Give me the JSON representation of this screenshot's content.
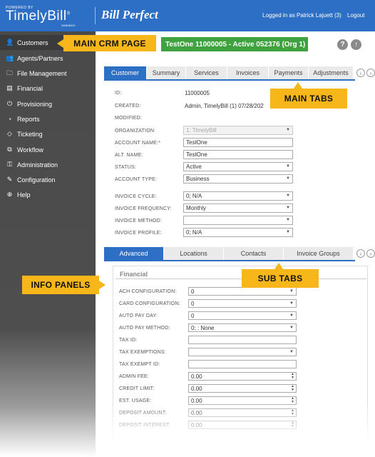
{
  "header": {
    "powered_by": "POWERED BY",
    "logo": "TimelyBill",
    "logo_reg": "®",
    "logo_sub": "SANDBOX",
    "brand": "Bill Perfect",
    "user": "Logged in as Patrick Lajuett (3)",
    "logout": "Logout"
  },
  "sidebar": {
    "items": [
      {
        "label": "Customers",
        "icon": "person-icon",
        "glyph": "👤"
      },
      {
        "label": "Agents/Partners",
        "icon": "people-icon",
        "glyph": "👥"
      },
      {
        "label": "File Management",
        "icon": "folder-icon",
        "glyph": "🗀"
      },
      {
        "label": "Financial",
        "icon": "ledger-icon",
        "glyph": "▤"
      },
      {
        "label": "Provisioning",
        "icon": "power-icon",
        "glyph": "⏻"
      },
      {
        "label": "Reports",
        "icon": "pie-chart-icon",
        "glyph": "◔"
      },
      {
        "label": "Ticketing",
        "icon": "tag-icon",
        "glyph": "◇"
      },
      {
        "label": "Workflow",
        "icon": "sitemap-icon",
        "glyph": "⧉"
      },
      {
        "label": "Administration",
        "icon": "key-icon",
        "glyph": "⚿"
      },
      {
        "label": "Configuration",
        "icon": "wrench-icon",
        "glyph": "✎"
      },
      {
        "label": "Help",
        "icon": "lifebuoy-icon",
        "glyph": "⊕"
      }
    ]
  },
  "callouts": {
    "main_crm": "MAIN CRM PAGE",
    "main_tabs": "MAIN TABS",
    "sub_tabs": "SUB TABS",
    "info_panels": "INFO PANELS"
  },
  "record": {
    "title": "TestOne   11000005 - Active 052376 (Org 1)",
    "help": "?",
    "up": "↑"
  },
  "main_tabs": [
    "Customer",
    "Summary",
    "Services",
    "Invoices",
    "Payments",
    "Adjustments"
  ],
  "sub_tabs": [
    "Advanced",
    "Locations",
    "Contacts",
    "Invoice Groups"
  ],
  "nav": {
    "prev": "‹",
    "next": "›"
  },
  "customer": {
    "id_label": "ID:",
    "id_value": "11000005",
    "created_label": "CREATED:",
    "created_value": "Admin, TimelyBill (1) 07/28/202",
    "modified_label": "MODIFIED:",
    "organization_label": "ORGANIZATION:",
    "organization_value": "1: TimelyBill",
    "account_name_label": "ACCOUNT NAME:",
    "account_name_value": "TestOne",
    "alt_name_label": "ALT. NAME:",
    "alt_name_value": "TestOne",
    "status_label": "STATUS:",
    "status_value": "Active",
    "account_type_label": "ACCOUNT TYPE:",
    "account_type_value": "Business",
    "invoice_cycle_label": "INVOICE CYCLE:",
    "invoice_cycle_value": "0; N/A",
    "invoice_frequency_label": "INVOICE FREQUENCY:",
    "invoice_frequency_value": "Monthly",
    "invoice_method_label": "INVOICE METHOD:",
    "invoice_method_value": "",
    "invoice_profile_label": "INVOICE PROFILE:",
    "invoice_profile_value": "0; N/A"
  },
  "financial": {
    "title": "Financial",
    "rows": [
      {
        "label": "ACH CONFIGURATION:",
        "value": "0",
        "kind": "select"
      },
      {
        "label": "CARD CONFIGURATION:",
        "value": "0",
        "kind": "select"
      },
      {
        "label": "AUTO PAY DAY:",
        "value": "0",
        "kind": "select"
      },
      {
        "label": "AUTO PAY METHOD:",
        "value": "0: : None",
        "kind": "select"
      },
      {
        "label": "TAX ID:",
        "value": "",
        "kind": "text"
      },
      {
        "label": "TAX EXEMPTIONS:",
        "value": "",
        "kind": "select"
      },
      {
        "label": "TAX EXEMPT ID:",
        "value": "",
        "kind": "text"
      },
      {
        "label": "ADMIN FEE:",
        "value": "0.00",
        "kind": "number"
      },
      {
        "label": "CREDIT LIMIT:",
        "value": "0.00",
        "kind": "number"
      },
      {
        "label": "EST. USAGE:",
        "value": "0.00",
        "kind": "number"
      },
      {
        "label": "DEPOSIT AMOUNT:",
        "value": "0.00",
        "kind": "number"
      },
      {
        "label": "DEPOSIT INTEREST:",
        "value": "0.00",
        "kind": "number"
      }
    ]
  },
  "colors": {
    "brand_blue": "#2d6fc4",
    "accent_yellow": "#f7b71b",
    "active_green": "#3ea23e"
  }
}
